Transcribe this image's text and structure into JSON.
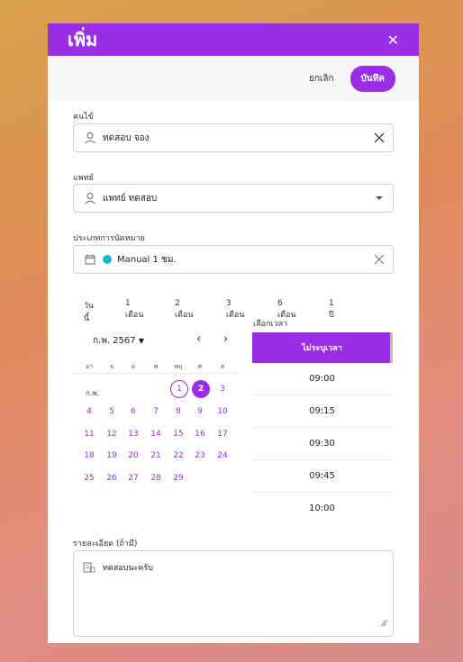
{
  "dialog": {
    "title": "เพิ่ม",
    "close_icon": "close-icon"
  },
  "actions": {
    "cancel_label": "ยกเลิก",
    "save_label": "บันทึค"
  },
  "patient": {
    "label": "คนไข้",
    "value": "ทดสอบ จอง",
    "icon": "person-icon",
    "clear_icon": "clear-icon"
  },
  "doctor": {
    "label": "แพทย์",
    "value": "แพทย์ ทดสอบ",
    "icon": "person-icon",
    "dropdown_icon": "caret-down-icon"
  },
  "appointment_type": {
    "label": "ประเภทการนัดหมาย",
    "value": "Manual 1 ชม.",
    "icon": "calendar-icon",
    "color": "#12b8cf"
  },
  "periods": [
    "วันนี้",
    "1 เดือน",
    "2 เดือน",
    "3 เดือน",
    "6 เดือน",
    "1 ปี"
  ],
  "calendar": {
    "month_year": "ก.พ. 2567",
    "month_short": "ก.พ.",
    "weekdays": [
      "อา",
      "จ",
      "อ",
      "พ",
      "พฤ",
      "ศ",
      "ส"
    ],
    "days": [
      "1",
      "2",
      "3",
      "4",
      "5",
      "6",
      "7",
      "8",
      "9",
      "10",
      "11",
      "12",
      "13",
      "14",
      "15",
      "16",
      "17",
      "18",
      "19",
      "20",
      "21",
      "22",
      "23",
      "24",
      "25",
      "26",
      "27",
      "28",
      "29"
    ],
    "today": "1",
    "selected": "2"
  },
  "time": {
    "label": "เลือกเวลา",
    "none_label": "ไม่ระบุเวลา",
    "slots": [
      "09:00",
      "09:15",
      "09:30",
      "09:45",
      "10:00"
    ]
  },
  "notes": {
    "label": "รายละเอียด (ถ้ามี)",
    "value": "ทดสอบนะครับ",
    "icon": "notes-icon"
  },
  "colors": {
    "accent": "#9b2de6",
    "header": "#9b2de6"
  }
}
